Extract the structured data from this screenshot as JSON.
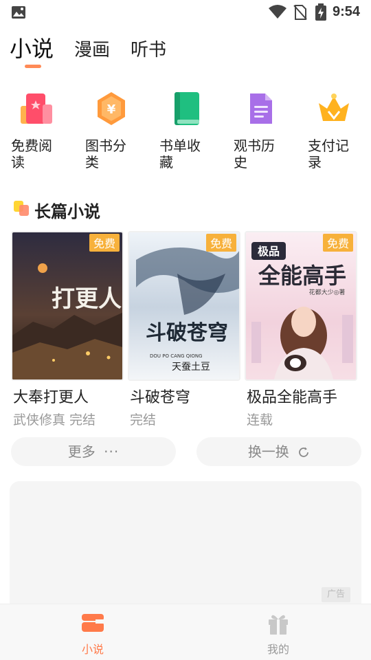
{
  "status_bar": {
    "time": "9:54",
    "icons": [
      "image-icon",
      "wifi-icon",
      "no-sim-icon",
      "battery-charging-icon"
    ]
  },
  "top_tabs": [
    {
      "label": "小说",
      "active": true
    },
    {
      "label": "漫画",
      "active": false
    },
    {
      "label": "听书",
      "active": false
    }
  ],
  "quick_entries": [
    {
      "label": "免费阅读",
      "icon": "free-read-icon"
    },
    {
      "label": "图书分类",
      "icon": "category-icon"
    },
    {
      "label": "书单收藏",
      "icon": "booklist-icon"
    },
    {
      "label": "观书历史",
      "icon": "history-icon"
    },
    {
      "label": "支付记录",
      "icon": "crown-icon"
    }
  ],
  "section": {
    "title": "长篇小说"
  },
  "books": [
    {
      "title": "大奉打更人",
      "subtitle": "武侠修真 完结",
      "badge": "免费",
      "cover_text": "打更人",
      "cover_colors": {
        "top": "#2a2a3e",
        "mid": "#6a4a3a",
        "bottom": "#1a1a1a"
      }
    },
    {
      "title": "斗破苍穹",
      "subtitle": "完结",
      "badge": "免费",
      "cover_text": "斗破苍穹",
      "cover_author": "天蚕土豆",
      "cover_small": "DOU PO CANG QIONG",
      "cover_colors": {
        "top": "#e8eef5",
        "mid": "#b8c6d6",
        "bottom": "#f4f6f8"
      }
    },
    {
      "title": "极品全能高手",
      "subtitle": "连载",
      "badge": "免费",
      "cover_text": "全能高手",
      "cover_top": "极品",
      "cover_author": "花都大少◎著",
      "cover_colors": {
        "top": "#f7e6ee",
        "mid": "#efc9d6",
        "bottom": "#f3d8e0"
      }
    }
  ],
  "actions": {
    "more_label": "更多",
    "more_icon": "ellipsis-icon",
    "swap_label": "换一换",
    "swap_icon": "refresh-icon"
  },
  "ad": {
    "tag": "广告"
  },
  "bottom_nav": [
    {
      "label": "小说",
      "icon": "book-stack-icon",
      "active": true
    },
    {
      "label": "我的",
      "icon": "gift-icon",
      "active": false
    }
  ],
  "colors": {
    "accent": "#ff8a56",
    "badge": "#f7b13b",
    "inactive_nav": "#999999"
  }
}
